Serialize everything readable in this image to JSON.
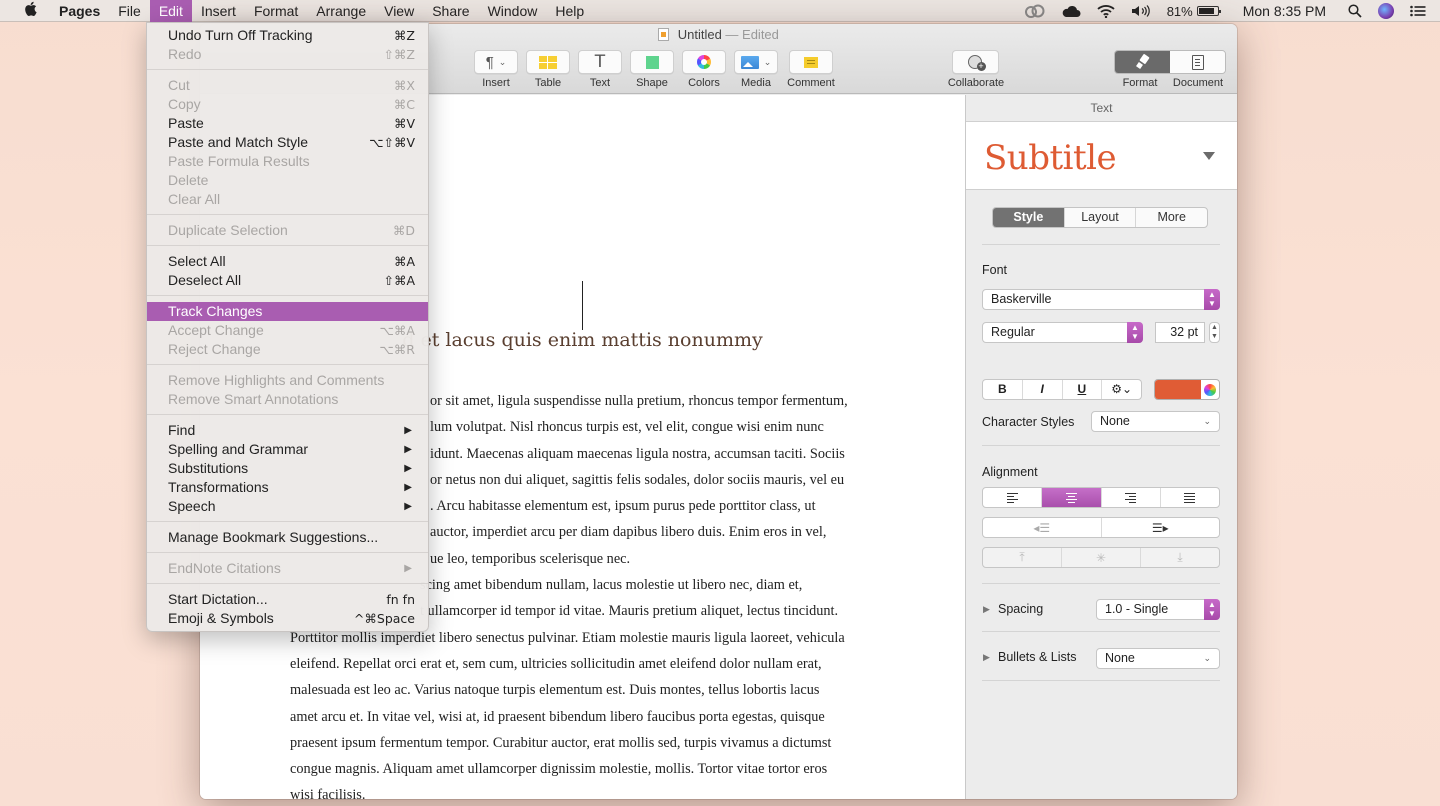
{
  "menubar": {
    "app_name": "Pages",
    "menus": [
      "File",
      "Edit",
      "Insert",
      "Format",
      "Arrange",
      "View",
      "Share",
      "Window",
      "Help"
    ],
    "active_menu": "Edit",
    "status": {
      "battery_percent": "81%",
      "clock": "Mon 8:35 PM"
    }
  },
  "window": {
    "title": "Untitled",
    "title_suffix": "— Edited",
    "toolbar": {
      "insert": "Insert",
      "table": "Table",
      "text": "Text",
      "shape": "Shape",
      "colors": "Colors",
      "media": "Media",
      "comment": "Comment",
      "collaborate": "Collaborate",
      "format": "Format",
      "document": "Document",
      "text_glyph": "T",
      "para_glyph": "¶"
    }
  },
  "document": {
    "subtitle_visible": "d et lacus quis enim mattis nonummy",
    "body_lines": [
      "or sit amet, ligula suspendisse nulla pretium, rhoncus tempor fermentum,",
      "lum volutpat. Nisl rhoncus turpis est, vel elit, congue wisi enim nunc",
      "idunt. Maecenas aliquam maecenas ligula nostra, accumsan taciti. Sociis",
      "or netus non dui aliquet, sagittis felis sodales, dolor sociis mauris, vel eu",
      ". Arcu habitasse elementum est, ipsum purus pede porttitor class, ut",
      "auctor, imperdiet arcu per diam dapibus libero duis. Enim eros in vel,",
      "ue leo, temporibus scelerisque nec.",
      "scing amet bibendum nullam, lacus molestie ut libero nec, diam et,",
      "t ullamcorper id tempor id vitae. Mauris pretium aliquet, lectus tincidunt.",
      "Porttitor mollis imperdiet libero senectus pulvinar. Etiam molestie mauris ligula laoreet, vehicula",
      "eleifend. Repellat orci erat et, sem cum, ultricies sollicitudin amet eleifend dolor nullam erat,",
      "malesuada est leo ac. Varius natoque turpis elementum est. Duis montes, tellus lobortis lacus",
      "amet arcu et. In vitae vel, wisi at, id praesent bibendum libero faucibus porta egestas, quisque",
      "praesent ipsum fermentum tempor. Curabitur auctor, erat mollis sed, turpis vivamus a dictumst",
      "congue magnis. Aliquam amet ullamcorper dignissim molestie, mollis. Tortor vitae tortor eros",
      "wisi facilisis."
    ]
  },
  "inspector": {
    "header": "Text",
    "paragraph_style": "Subtitle",
    "tabs": [
      "Style",
      "Layout",
      "More"
    ],
    "active_tab": "Style",
    "font_label": "Font",
    "font_family": "Baskerville",
    "font_typeface": "Regular",
    "font_size": "32 pt",
    "bold": "B",
    "italic": "I",
    "underline": "U",
    "gear": "⚙︎⌄",
    "text_color": "#e05c35",
    "character_styles_label": "Character Styles",
    "character_style": "None",
    "alignment_label": "Alignment",
    "alignment_selected": "center",
    "spacing_label": "Spacing",
    "spacing_value": "1.0 - Single",
    "bullets_label": "Bullets & Lists",
    "bullets_value": "None"
  },
  "edit_menu": {
    "items": [
      {
        "label": "Undo Turn Off Tracking",
        "shortcut": "⌘Z",
        "enabled": true
      },
      {
        "label": "Redo",
        "shortcut": "⇧⌘Z",
        "enabled": false
      },
      {
        "divider": true
      },
      {
        "label": "Cut",
        "shortcut": "⌘X",
        "enabled": false
      },
      {
        "label": "Copy",
        "shortcut": "⌘C",
        "enabled": false
      },
      {
        "label": "Paste",
        "shortcut": "⌘V",
        "enabled": true
      },
      {
        "label": "Paste and Match Style",
        "shortcut": "⌥⇧⌘V",
        "enabled": true
      },
      {
        "label": "Paste Formula Results",
        "shortcut": "",
        "enabled": false
      },
      {
        "label": "Delete",
        "shortcut": "",
        "enabled": false
      },
      {
        "label": "Clear All",
        "shortcut": "",
        "enabled": false
      },
      {
        "divider": true
      },
      {
        "label": "Duplicate Selection",
        "shortcut": "⌘D",
        "enabled": false
      },
      {
        "divider": true
      },
      {
        "label": "Select All",
        "shortcut": "⌘A",
        "enabled": true
      },
      {
        "label": "Deselect All",
        "shortcut": "⇧⌘A",
        "enabled": true
      },
      {
        "divider": true
      },
      {
        "label": "Track Changes",
        "shortcut": "",
        "enabled": true,
        "highlighted": true
      },
      {
        "label": "Accept Change",
        "shortcut": "⌥⌘A",
        "enabled": false
      },
      {
        "label": "Reject Change",
        "shortcut": "⌥⌘R",
        "enabled": false
      },
      {
        "divider": true
      },
      {
        "label": "Remove Highlights and Comments",
        "shortcut": "",
        "enabled": false
      },
      {
        "label": "Remove Smart Annotations",
        "shortcut": "",
        "enabled": false
      },
      {
        "divider": true
      },
      {
        "label": "Find",
        "submenu": true,
        "enabled": true
      },
      {
        "label": "Spelling and Grammar",
        "submenu": true,
        "enabled": true
      },
      {
        "label": "Substitutions",
        "submenu": true,
        "enabled": true
      },
      {
        "label": "Transformations",
        "submenu": true,
        "enabled": true
      },
      {
        "label": "Speech",
        "submenu": true,
        "enabled": true
      },
      {
        "divider": true
      },
      {
        "label": "Manage Bookmark Suggestions...",
        "shortcut": "",
        "enabled": true
      },
      {
        "divider": true
      },
      {
        "label": "EndNote Citations",
        "submenu": true,
        "enabled": false
      },
      {
        "divider": true
      },
      {
        "label": "Start Dictation...",
        "shortcut": "fn fn",
        "enabled": true
      },
      {
        "label": "Emoji & Symbols",
        "shortcut": "^⌘Space",
        "enabled": true
      }
    ]
  },
  "colors": {
    "accent": "#a95db1",
    "subtitle_style": "#de5b33"
  }
}
